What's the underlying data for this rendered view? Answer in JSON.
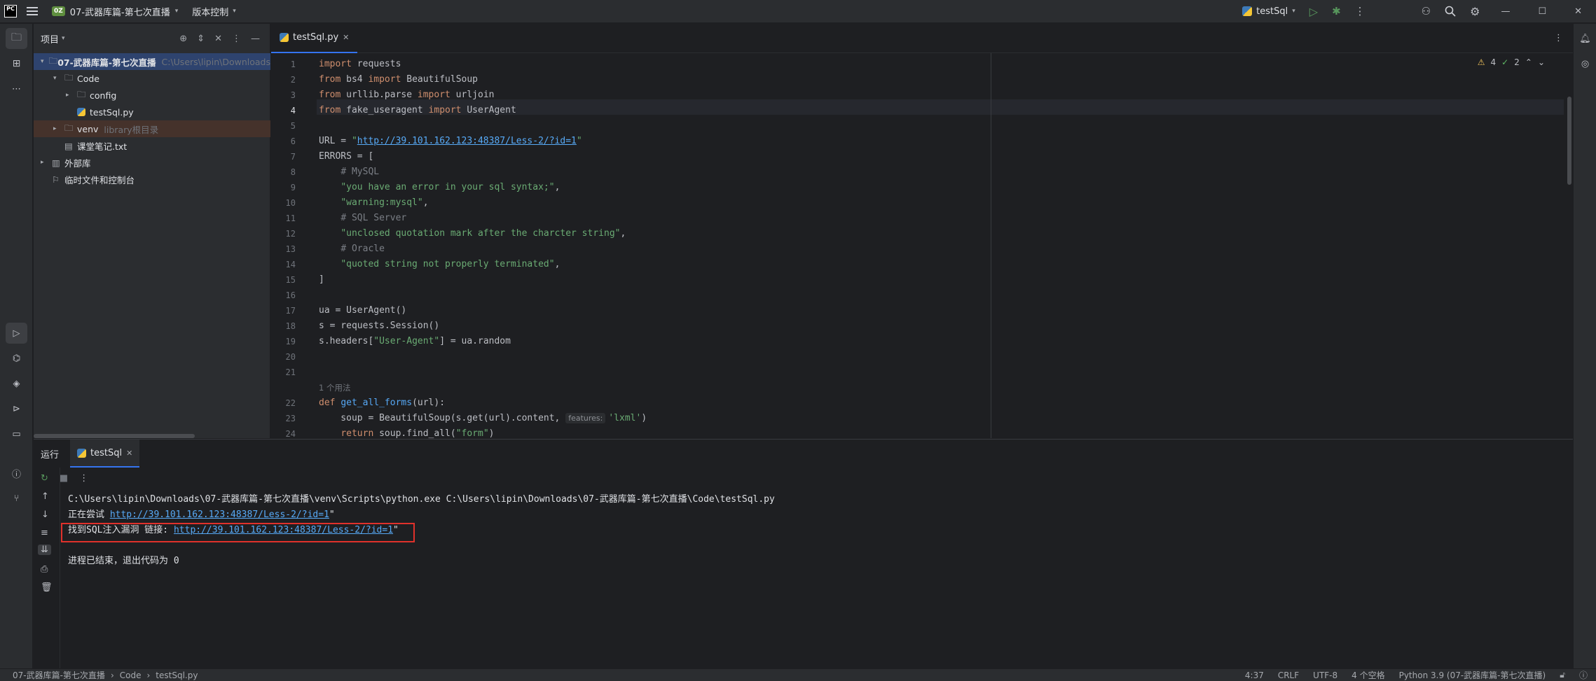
{
  "titlebar": {
    "app_logo": "PC",
    "project_badge": "0Z",
    "project_name": "07-武器库篇-第七次直播",
    "vcs_label": "版本控制",
    "run_config": "testSql"
  },
  "project_panel": {
    "title": "项目",
    "tree": [
      {
        "label": "07-武器库篇-第七次直播",
        "hint": "C:\\Users\\lipin\\Downloads",
        "depth": 0,
        "kind": "folder"
      },
      {
        "label": "Code",
        "hint": "",
        "depth": 1,
        "kind": "folder"
      },
      {
        "label": "config",
        "hint": "",
        "depth": 2,
        "kind": "folder"
      },
      {
        "label": "testSql.py",
        "hint": "",
        "depth": 2,
        "kind": "python"
      },
      {
        "label": "venv",
        "hint": "library根目录",
        "depth": 1,
        "kind": "folder"
      },
      {
        "label": "课堂笔记.txt",
        "hint": "",
        "depth": 1,
        "kind": "text"
      },
      {
        "label": "外部库",
        "hint": "",
        "depth": 0,
        "kind": "lib"
      },
      {
        "label": "临时文件和控制台",
        "hint": "",
        "depth": 0,
        "kind": "scratch"
      }
    ]
  },
  "editor": {
    "tab_label": "testSql.py",
    "warnings": "4",
    "checks": "2",
    "usage_hint": "1 个用法",
    "inlay_hint": "features:",
    "lines": [
      [
        [
          "kw",
          "import"
        ],
        [
          "t",
          " requests"
        ]
      ],
      [
        [
          "kw",
          "from"
        ],
        [
          "t",
          " bs4 "
        ],
        [
          "kw",
          "import"
        ],
        [
          "t",
          " BeautifulSoup"
        ]
      ],
      [
        [
          "kw",
          "from"
        ],
        [
          "t",
          " urllib.parse "
        ],
        [
          "kw",
          "import"
        ],
        [
          "t",
          " urljoin"
        ]
      ],
      [
        [
          "kw",
          "from"
        ],
        [
          "t",
          " fake_useragent "
        ],
        [
          "kw",
          "import"
        ],
        [
          "t",
          " UserAgent"
        ]
      ],
      [],
      [
        [
          "t",
          "URL = "
        ],
        [
          "str",
          "\""
        ],
        [
          "url",
          "http://39.101.162.123:48387/Less-2/?id=1"
        ],
        [
          "str",
          "\""
        ]
      ],
      [
        [
          "t",
          "ERRORS = ["
        ]
      ],
      [
        [
          "t",
          "    "
        ],
        [
          "cm",
          "# MySQL"
        ]
      ],
      [
        [
          "t",
          "    "
        ],
        [
          "str",
          "\"you have an error in your sql syntax;\""
        ],
        [
          "t",
          ","
        ]
      ],
      [
        [
          "t",
          "    "
        ],
        [
          "str",
          "\"warning:mysql\""
        ],
        [
          "t",
          ","
        ]
      ],
      [
        [
          "t",
          "    "
        ],
        [
          "cm",
          "# SQL Server"
        ]
      ],
      [
        [
          "t",
          "    "
        ],
        [
          "str",
          "\"unclosed quotation mark after the charcter string\""
        ],
        [
          "t",
          ","
        ]
      ],
      [
        [
          "t",
          "    "
        ],
        [
          "cm",
          "# Oracle"
        ]
      ],
      [
        [
          "t",
          "    "
        ],
        [
          "str",
          "\"quoted string not properly terminated\""
        ],
        [
          "t",
          ","
        ]
      ],
      [
        [
          "t",
          "]"
        ]
      ],
      [],
      [
        [
          "t",
          "ua = UserAgent()"
        ]
      ],
      [
        [
          "t",
          "s = requests.Session()"
        ]
      ],
      [
        [
          "t",
          "s.headers["
        ],
        [
          "str",
          "\"User-Agent\""
        ],
        [
          "t",
          "] = ua.random"
        ]
      ],
      [],
      [],
      [
        [
          "kw",
          "def"
        ],
        [
          "t",
          " "
        ],
        [
          "fn",
          "get_all_forms"
        ],
        [
          "t",
          "(url):"
        ]
      ],
      [
        [
          "t",
          "    soup = BeautifulSoup(s.get(url).content, "
        ],
        [
          "hint",
          ""
        ],
        [
          "str",
          "'lxml'"
        ],
        [
          "t",
          ")"
        ]
      ],
      [
        [
          "t",
          "    "
        ],
        [
          "kw",
          "return"
        ],
        [
          "t",
          " soup.find_all("
        ],
        [
          "str",
          "\"form\""
        ],
        [
          "t",
          ")"
        ]
      ]
    ],
    "line_numbers": [
      "1",
      "2",
      "3",
      "4",
      "5",
      "6",
      "7",
      "8",
      "9",
      "10",
      "11",
      "12",
      "13",
      "14",
      "15",
      "16",
      "17",
      "18",
      "19",
      "20",
      "21",
      "22",
      "23",
      "24"
    ]
  },
  "run_panel": {
    "title": "运行",
    "tab_label": "testSql",
    "console": [
      {
        "text": "C:\\Users\\lipin\\Downloads\\07-武器库篇-第七次直播\\venv\\Scripts\\python.exe C:\\Users\\lipin\\Downloads\\07-武器库篇-第七次直播\\Code\\testSql.py",
        "prefix": "",
        "link": "",
        "suffix": ""
      },
      {
        "text": "",
        "prefix": "正在尝试 ",
        "link": "http://39.101.162.123:48387/Less-2/?id=1",
        "suffix": "\""
      },
      {
        "text": "",
        "prefix": "找到SQL注入漏洞 链接: ",
        "link": "http://39.101.162.123:48387/Less-2/?id=1",
        "suffix": "\""
      },
      {
        "text": "",
        "prefix": "",
        "link": "",
        "suffix": ""
      },
      {
        "text": "进程已结束，退出代码为 0",
        "prefix": "",
        "link": "",
        "suffix": ""
      }
    ]
  },
  "statusbar": {
    "breadcrumb": [
      "07-武器库篇-第七次直播",
      "Code",
      "testSql.py"
    ],
    "position": "4:37",
    "line_sep": "CRLF",
    "encoding": "UTF-8",
    "indent": "4 个空格",
    "interpreter": "Python 3.9 (07-武器库篇-第七次直播)"
  },
  "colors": {
    "accent": "#3574f0",
    "highlight_box": "#e0312b",
    "keyword": "#cf8e6d",
    "string": "#6aab73",
    "comment": "#7a7e85"
  }
}
